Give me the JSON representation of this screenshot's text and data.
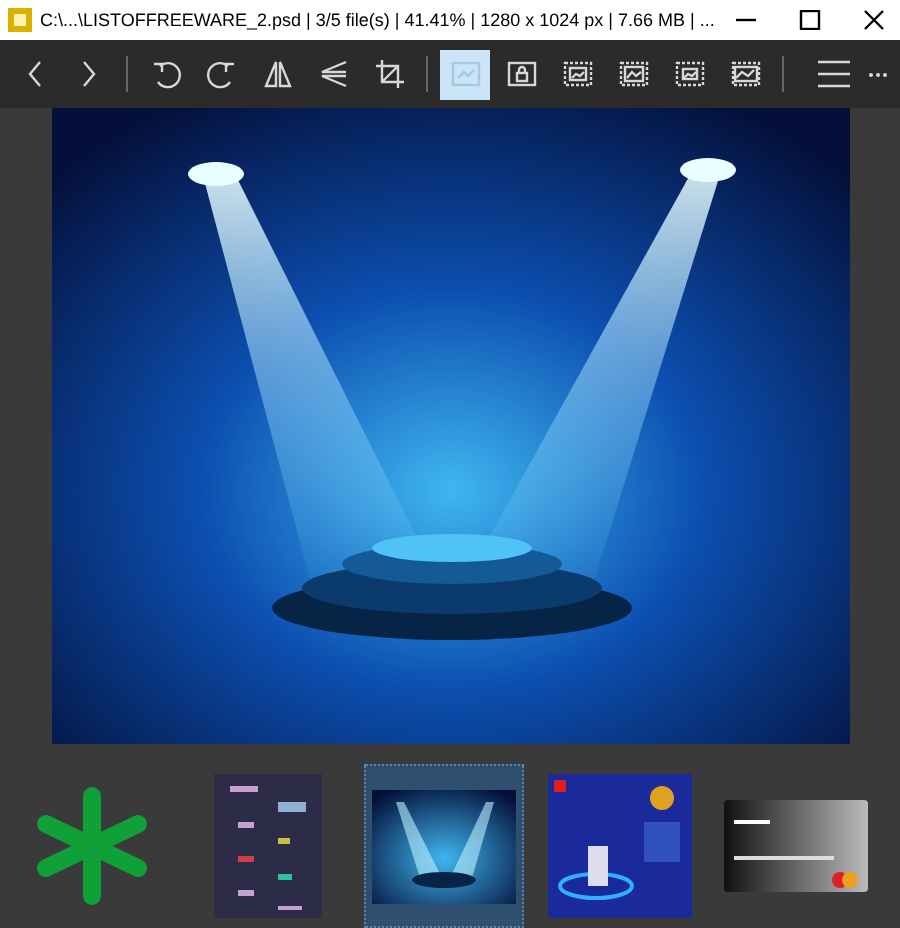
{
  "window": {
    "title": "C:\\...\\LISTOFFREEWARE_2.psd | 3/5 file(s) | 41.41% | 1280 x 1024 px | 7.66 MB | ..."
  },
  "view_modes": [
    {
      "selected": true
    },
    {
      "selected": false
    },
    {
      "selected": false
    },
    {
      "selected": false
    },
    {
      "selected": false
    },
    {
      "selected": false
    }
  ],
  "thumbnails": [
    {
      "kind": "logo",
      "selected": false
    },
    {
      "kind": "diagram",
      "selected": false
    },
    {
      "kind": "stage",
      "selected": true
    },
    {
      "kind": "poster",
      "selected": false
    },
    {
      "kind": "card",
      "selected": false
    }
  ]
}
